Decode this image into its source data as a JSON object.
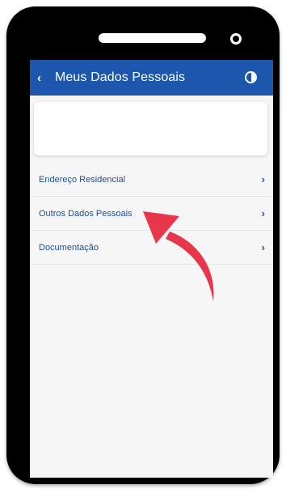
{
  "appbar": {
    "back_icon": "chevron-left-icon",
    "back_glyph": "‹",
    "title": "Meus Dados Pessoais",
    "contrast_icon": "contrast-icon"
  },
  "menu": {
    "items": [
      {
        "label": "Endereço Residencial",
        "chevron": "›"
      },
      {
        "label": "Outros Dados Pessoais",
        "chevron": "›"
      },
      {
        "label": "Documentação",
        "chevron": "›"
      }
    ]
  },
  "colors": {
    "brand": "#1d56ad",
    "link_text": "#1d4f96",
    "annotation_arrow": "#e8364a"
  }
}
